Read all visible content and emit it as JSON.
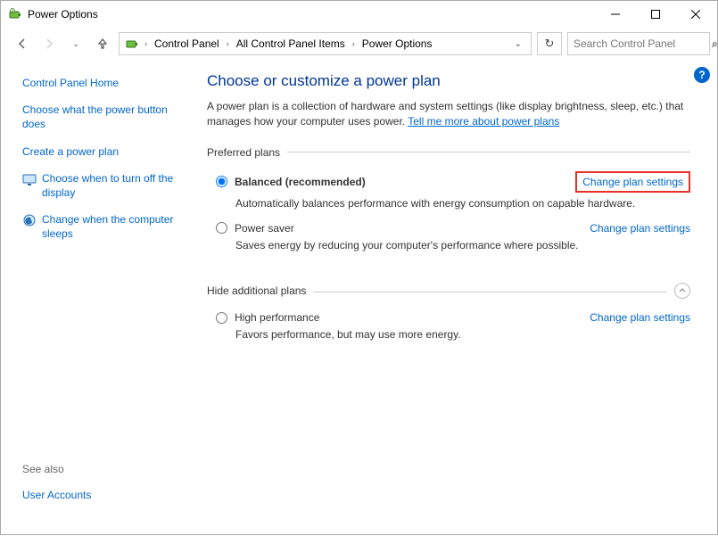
{
  "window": {
    "title": "Power Options"
  },
  "breadcrumb": {
    "seg1": "Control Panel",
    "seg2": "All Control Panel Items",
    "seg3": "Power Options"
  },
  "search": {
    "placeholder": "Search Control Panel"
  },
  "sidebar": {
    "home": "Control Panel Home",
    "link1": "Choose what the power button does",
    "link2": "Create a power plan",
    "link3": "Choose when to turn off the display",
    "link4": "Change when the computer sleeps",
    "see_also": "See also",
    "user_accounts": "User Accounts"
  },
  "content": {
    "heading": "Choose or customize a power plan",
    "description": "A power plan is a collection of hardware and system settings (like display brightness, sleep, etc.) that manages how your computer uses power. ",
    "tell_me_more": "Tell me more about power plans",
    "preferred_legend": "Preferred plans",
    "hide_legend": "Hide additional plans",
    "change_link": "Change plan settings",
    "plans": {
      "balanced": {
        "label": "Balanced (recommended)",
        "desc": "Automatically balances performance with energy consumption on capable hardware."
      },
      "powersaver": {
        "label": "Power saver",
        "desc": "Saves energy by reducing your computer's performance where possible."
      },
      "highperf": {
        "label": "High performance",
        "desc": "Favors performance, but may use more energy."
      }
    }
  }
}
